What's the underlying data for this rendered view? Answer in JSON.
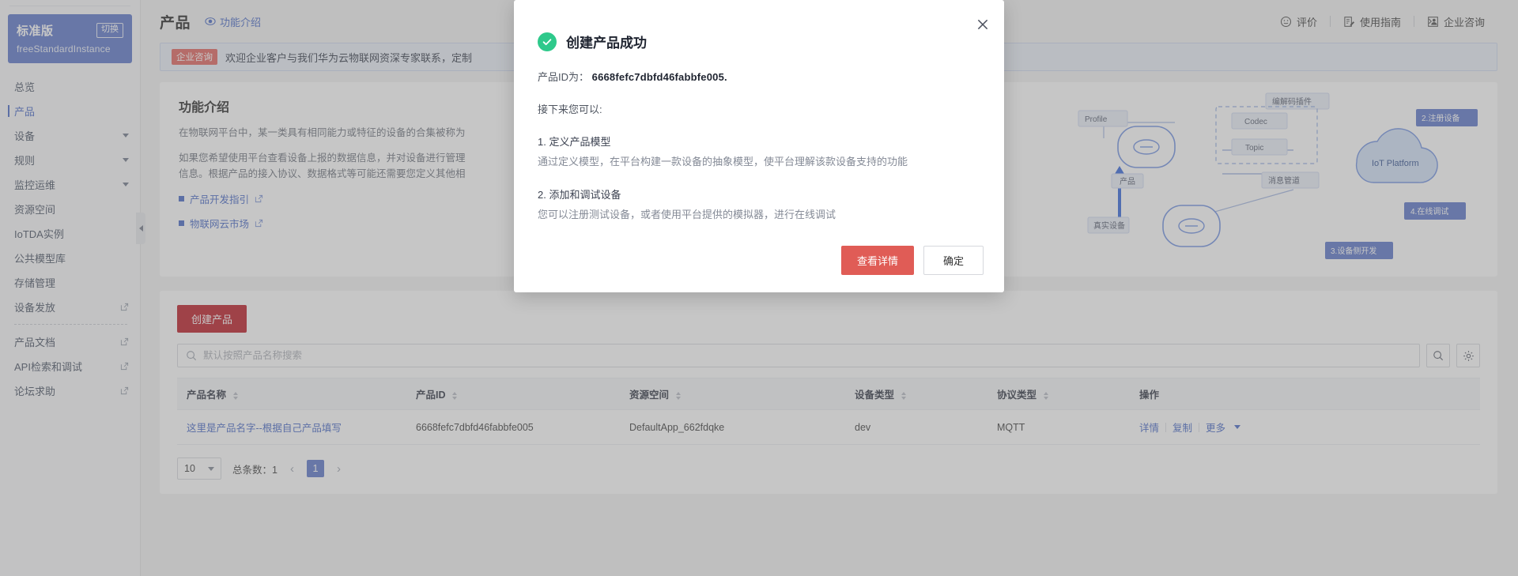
{
  "sidebar": {
    "instance": {
      "edition": "标准版",
      "switch_label": "切换",
      "instance_name": "freeStandardInstance"
    },
    "items": [
      {
        "label": "总览",
        "type": "plain"
      },
      {
        "label": "产品",
        "type": "active"
      },
      {
        "label": "设备",
        "type": "expandable"
      },
      {
        "label": "规则",
        "type": "expandable"
      },
      {
        "label": "监控运维",
        "type": "expandable"
      },
      {
        "label": "资源空间",
        "type": "plain"
      },
      {
        "label": "IoTDA实例",
        "type": "plain"
      },
      {
        "label": "公共模型库",
        "type": "plain"
      },
      {
        "label": "存储管理",
        "type": "plain"
      },
      {
        "label": "设备发放",
        "type": "external"
      },
      {
        "label": "产品文档",
        "type": "external"
      },
      {
        "label": "API检索和调试",
        "type": "external"
      },
      {
        "label": "论坛求助",
        "type": "external"
      }
    ]
  },
  "header": {
    "title": "产品",
    "feature_link": "功能介绍",
    "right_items": [
      {
        "label": "评价",
        "icon": "smiley-icon"
      },
      {
        "label": "使用指南",
        "icon": "guide-icon"
      },
      {
        "label": "企业咨询",
        "icon": "consult-icon"
      }
    ]
  },
  "banner": {
    "tag": "企业咨询",
    "text": "欢迎企业客户与我们华为云物联网资深专家联系，定制"
  },
  "intro": {
    "title": "功能介绍",
    "paragraph1": "在物联网平台中，某一类具有相同能力或特征的设备的合集被称为",
    "paragraph2_line1": "如果您希望使用平台查看设备上报的数据信息，并对设备进行管理",
    "paragraph2_line2": "信息。根据产品的接入协议、数据格式等可能还需要您定义其他相",
    "links": [
      {
        "label": "产品开发指引"
      },
      {
        "label": "物联网云市场"
      }
    ],
    "diagram_labels": {
      "profile": "Profile",
      "codec": "Codec",
      "topic": "Topic",
      "plugin": "编解码插件",
      "product": "产品",
      "message_channel": "消息管道",
      "iot_platform": "IoT Platform",
      "real_device": "真实设备",
      "step2": "2.注册设备",
      "step3": "3.设备侧开发",
      "step4": "4.在线调试"
    }
  },
  "list": {
    "create_button": "创建产品",
    "search_placeholder": "默认按照产品名称搜索",
    "search_value": "",
    "search_icon": "search-icon",
    "settings_icon": "gear-icon",
    "columns": [
      "产品名称",
      "产品ID",
      "资源空间",
      "设备类型",
      "协议类型",
      "操作"
    ],
    "rows": [
      {
        "name": "这里是产品名字--根据自己产品填写",
        "id": "6668fefc7dbfd46fabbfe005",
        "space": "DefaultApp_662fdqke",
        "device_type": "dev",
        "protocol": "MQTT",
        "ops": [
          "详情",
          "复制",
          "更多"
        ]
      }
    ],
    "pager": {
      "page_size": "10",
      "total_label": "总条数：1",
      "current_page": "1"
    }
  },
  "modal": {
    "title": "创建产品成功",
    "id_label": "产品ID为：",
    "product_id": "6668fefc7dbfd46fabbfe005.",
    "next_label": "接下来您可以:",
    "steps": [
      {
        "title": "1. 定义产品模型",
        "desc": "通过定义模型，在平台构建一款设备的抽象模型，使平台理解该款设备支持的功能"
      },
      {
        "title": "2. 添加和调试设备",
        "desc": "您可以注册测试设备，或者使用平台提供的模拟器，进行在线调试"
      }
    ],
    "primary_button": "查看详情",
    "secondary_button": "确定",
    "close_icon": "close-icon",
    "success_icon": "check-circle-icon"
  },
  "colors": {
    "brand_red": "#b80f1b",
    "accent_blue": "#3f62c4",
    "instance_blue": "#5570c6",
    "success_green": "#2ec98b",
    "modal_primary": "#e05c56"
  }
}
